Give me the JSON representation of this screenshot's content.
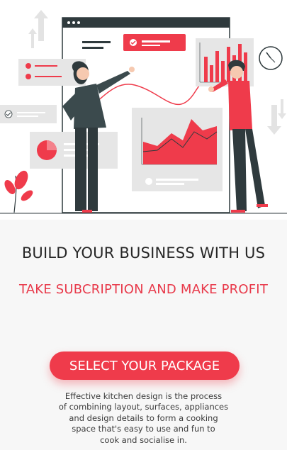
{
  "hero": {
    "illustration": "business-analytics-illustration",
    "colors": {
      "accent": "#ef3b4b",
      "dark": "#2f3a3d",
      "panel": "#e6e6e6"
    }
  },
  "headline": "BUILD YOUR BUSINESS WITH US",
  "subheadline": "TAKE SUBCRIPTION AND MAKE PROFIT",
  "cta": {
    "label": "SELECT YOUR PACKAGE"
  },
  "description": [
    "Effective kitchen design is the process",
    "of combining layout, surfaces, appliances",
    "and design details to form a cooking",
    "space that's easy to use and fun to",
    "cook and socialise in."
  ]
}
